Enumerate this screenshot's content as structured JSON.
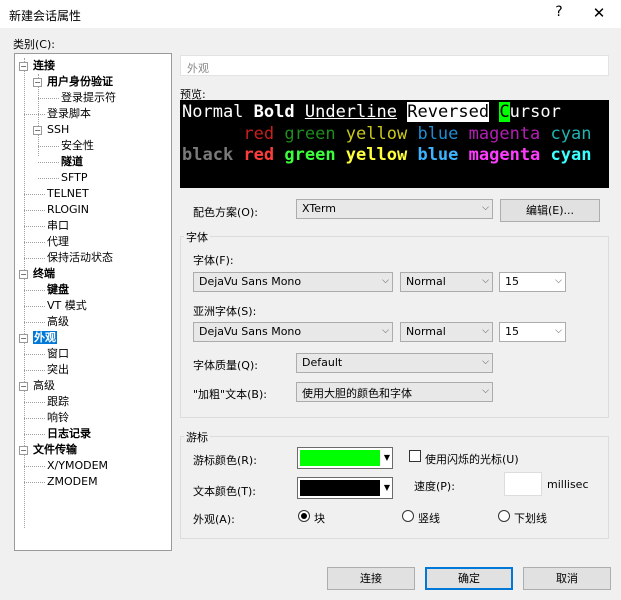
{
  "window": {
    "title": "新建会话属性",
    "help": "?",
    "close": "✕"
  },
  "category_label": "类别(C):",
  "tree": [
    {
      "label": "连接",
      "bold": true,
      "level": 0,
      "toggle": "−"
    },
    {
      "label": "用户身份验证",
      "bold": true,
      "level": 1,
      "toggle": "−"
    },
    {
      "label": "登录提示符",
      "bold": false,
      "level": 2
    },
    {
      "label": "登录脚本",
      "bold": false,
      "level": 1
    },
    {
      "label": "SSH",
      "bold": false,
      "level": 1,
      "toggle": "−"
    },
    {
      "label": "安全性",
      "bold": false,
      "level": 2
    },
    {
      "label": "隧道",
      "bold": true,
      "level": 2
    },
    {
      "label": "SFTP",
      "bold": false,
      "level": 2
    },
    {
      "label": "TELNET",
      "bold": false,
      "level": 1
    },
    {
      "label": "RLOGIN",
      "bold": false,
      "level": 1
    },
    {
      "label": "串口",
      "bold": false,
      "level": 1
    },
    {
      "label": "代理",
      "bold": false,
      "level": 1
    },
    {
      "label": "保持活动状态",
      "bold": false,
      "level": 1
    },
    {
      "label": "终端",
      "bold": true,
      "level": 0,
      "toggle": "−"
    },
    {
      "label": "键盘",
      "bold": true,
      "level": 1
    },
    {
      "label": "VT 模式",
      "bold": false,
      "level": 1
    },
    {
      "label": "高级",
      "bold": false,
      "level": 1
    },
    {
      "label": "外观",
      "bold": true,
      "level": 0,
      "toggle": "−",
      "selected": true
    },
    {
      "label": "窗口",
      "bold": false,
      "level": 1
    },
    {
      "label": "突出",
      "bold": false,
      "level": 1
    },
    {
      "label": "高级",
      "bold": false,
      "level": 0,
      "toggle": "−"
    },
    {
      "label": "跟踪",
      "bold": false,
      "level": 1
    },
    {
      "label": "响铃",
      "bold": false,
      "level": 1
    },
    {
      "label": "日志记录",
      "bold": true,
      "level": 1
    },
    {
      "label": "文件传输",
      "bold": true,
      "level": 0,
      "toggle": "−"
    },
    {
      "label": "X/YMODEM",
      "bold": false,
      "level": 1
    },
    {
      "label": "ZMODEM",
      "bold": false,
      "level": 1
    }
  ],
  "header": "外观",
  "preview": {
    "label": "预览:",
    "line1": [
      {
        "t": "Normal ",
        "c": "#ffffff",
        "bg": "",
        "b": false,
        "u": false
      },
      {
        "t": "Bold",
        "c": "#ffffff",
        "bg": "",
        "b": true,
        "u": false
      },
      {
        "t": " ",
        "c": "#ffffff",
        "bg": "",
        "b": false,
        "u": false
      },
      {
        "t": "Underline",
        "c": "#ffffff",
        "bg": "",
        "b": false,
        "u": true
      },
      {
        "t": " ",
        "c": "#ffffff",
        "bg": "",
        "b": false,
        "u": false
      },
      {
        "t": "Reversed",
        "c": "#000000",
        "bg": "#ffffff",
        "b": false,
        "u": false
      },
      {
        "t": " ",
        "c": "#ffffff",
        "bg": "",
        "b": false,
        "u": false
      },
      {
        "t": "C",
        "c": "#000000",
        "bg": "#00ff00",
        "b": false,
        "u": false
      },
      {
        "t": "ursor",
        "c": "#ffffff",
        "bg": "",
        "b": false,
        "u": false
      }
    ],
    "line2": [
      {
        "t": "black ",
        "c": "#000000",
        "bg": "",
        "b": false,
        "u": false
      },
      {
        "t": "red ",
        "c": "#c81e1e",
        "bg": "",
        "b": false,
        "u": false
      },
      {
        "t": "green ",
        "c": "#1e8c1e",
        "bg": "",
        "b": false,
        "u": false
      },
      {
        "t": "yellow ",
        "c": "#c8c81e",
        "bg": "",
        "b": false,
        "u": false
      },
      {
        "t": "blue ",
        "c": "#1e8cd2",
        "bg": "",
        "b": false,
        "u": false
      },
      {
        "t": "magenta ",
        "c": "#b41eb4",
        "bg": "",
        "b": false,
        "u": false
      },
      {
        "t": "cyan",
        "c": "#1eb4b4",
        "bg": "",
        "b": false,
        "u": false
      }
    ],
    "line3": [
      {
        "t": "black ",
        "c": "#7a7a7a",
        "bg": "",
        "b": true,
        "u": false
      },
      {
        "t": "red ",
        "c": "#ff3c3c",
        "bg": "",
        "b": true,
        "u": false
      },
      {
        "t": "green ",
        "c": "#3cff3c",
        "bg": "",
        "b": true,
        "u": false
      },
      {
        "t": "yellow ",
        "c": "#ffff3c",
        "bg": "",
        "b": true,
        "u": false
      },
      {
        "t": "blue ",
        "c": "#3cb4ff",
        "bg": "",
        "b": true,
        "u": false
      },
      {
        "t": "magenta ",
        "c": "#ff3cff",
        "bg": "",
        "b": true,
        "u": false
      },
      {
        "t": "cyan",
        "c": "#3cffff",
        "bg": "",
        "b": true,
        "u": false
      }
    ]
  },
  "scheme": {
    "label": "配色方案(O):",
    "value": "XTerm",
    "edit_button": "编辑(E)..."
  },
  "font_group": {
    "title": "字体",
    "font_label": "字体(F):",
    "font": "DejaVu Sans Mono",
    "style": "Normal",
    "size": "15",
    "asian_label": "亚洲字体(S):",
    "asian_font": "DejaVu Sans Mono",
    "asian_style": "Normal",
    "asian_size": "15",
    "quality_label": "字体质量(Q):",
    "quality": "Default",
    "bold_label": "\"加粗\"文本(B):",
    "bold_value": "使用大胆的颜色和字体"
  },
  "cursor_group": {
    "title": "游标",
    "cursor_color_label": "游标颜色(R):",
    "cursor_color": "#00ff00",
    "text_color_label": "文本颜色(T):",
    "text_color": "#000000",
    "blink_label": "使用闪烁的光标(U)",
    "speed_label": "速度(P):",
    "speed_value": "",
    "speed_unit": "millisec",
    "shape_label": "外观(A):",
    "shape_block": "块",
    "shape_vbar": "竖线",
    "shape_underline": "下划线"
  },
  "footer": {
    "connect": "连接",
    "ok": "确定",
    "cancel": "取消"
  }
}
